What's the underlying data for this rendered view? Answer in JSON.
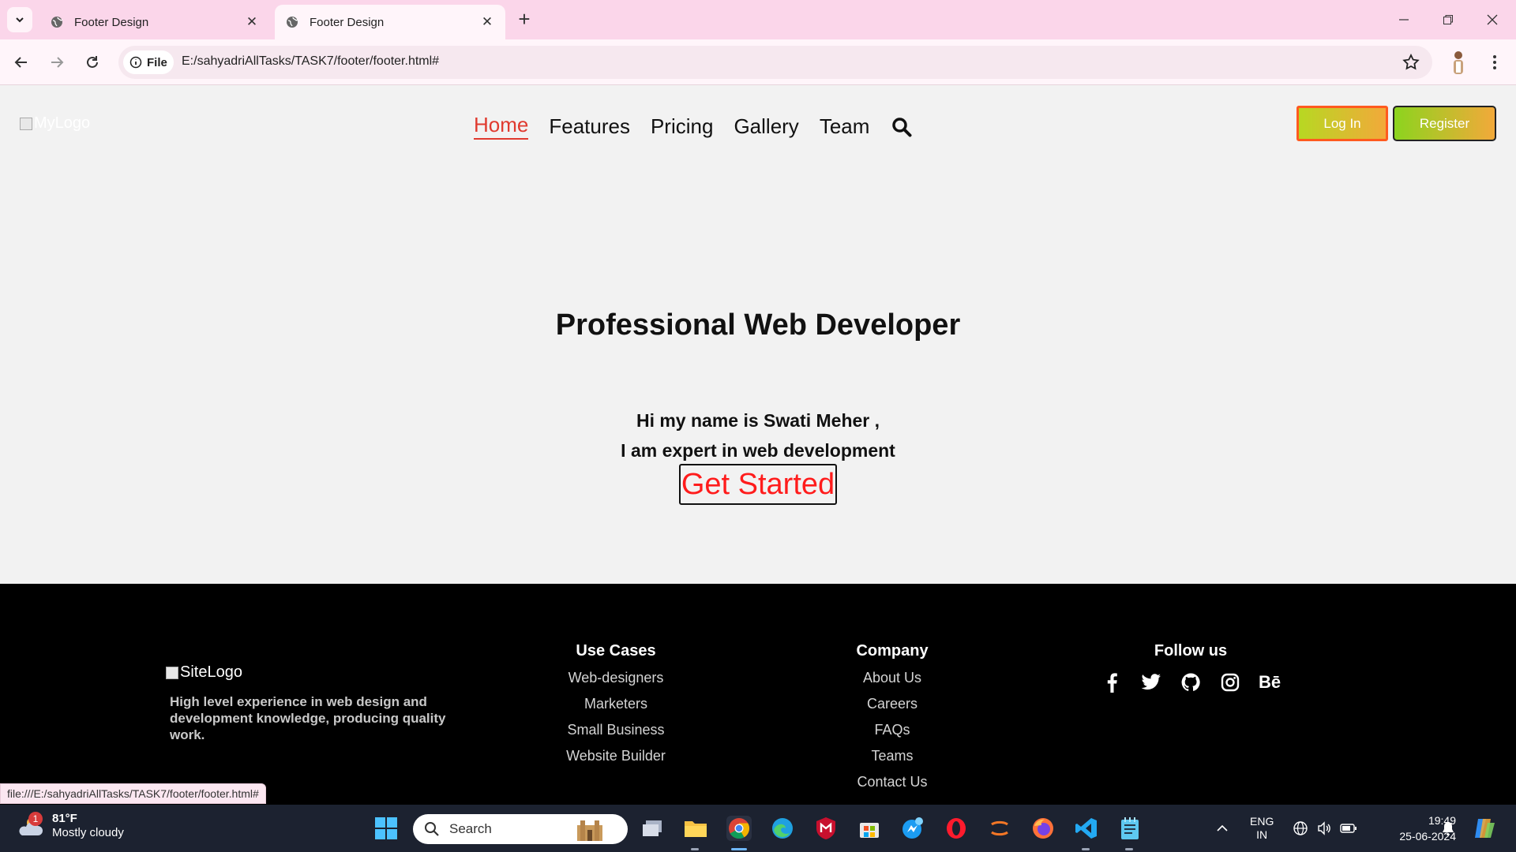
{
  "browser": {
    "tabs": [
      {
        "title": "Footer Design",
        "active": false
      },
      {
        "title": "Footer Design",
        "active": true
      }
    ],
    "address_chip": "File",
    "url": "E:/sahyadriAllTasks/TASK7/footer/footer.html#",
    "status_url": "file:///E:/sahyadriAllTasks/TASK7/footer/footer.html#"
  },
  "header": {
    "logo_alt": "MyLogo",
    "nav": [
      "Home",
      "Features",
      "Pricing",
      "Gallery",
      "Team"
    ],
    "active_nav": "Home",
    "login_label": "Log In",
    "register_label": "Register"
  },
  "hero": {
    "title": "Professional Web Developer",
    "line1": "Hi my name is Swati Meher ,",
    "line2": "I am expert in web development",
    "cta": "Get Started"
  },
  "footer": {
    "logo_alt": "SiteLogo",
    "description": "High level experience in web design and development knowledge, producing quality work.",
    "use_cases": {
      "heading": "Use Cases",
      "links": [
        "Web-designers",
        "Marketers",
        "Small Business",
        "Website Builder"
      ]
    },
    "company": {
      "heading": "Company",
      "links": [
        "About Us",
        "Careers",
        "FAQs",
        "Teams",
        "Contact Us"
      ]
    },
    "follow": {
      "heading": "Follow us",
      "icons": [
        "facebook-icon",
        "twitter-icon",
        "github-icon",
        "instagram-icon",
        "behance-icon"
      ],
      "behance_text": "Bē"
    }
  },
  "taskbar": {
    "weather_badge": "1",
    "temperature": "81°F",
    "condition": "Mostly cloudy",
    "search_placeholder": "Search",
    "lang_top": "ENG",
    "lang_bottom": "IN",
    "time": "19:49",
    "date": "25-06-2024"
  },
  "colors": {
    "accent_red": "#e03a2f",
    "cta_red": "#ff1c1c",
    "tabbar_pink": "#fbd6ea",
    "footer_bg": "#000000",
    "taskbar_bg": "#1c2230"
  }
}
